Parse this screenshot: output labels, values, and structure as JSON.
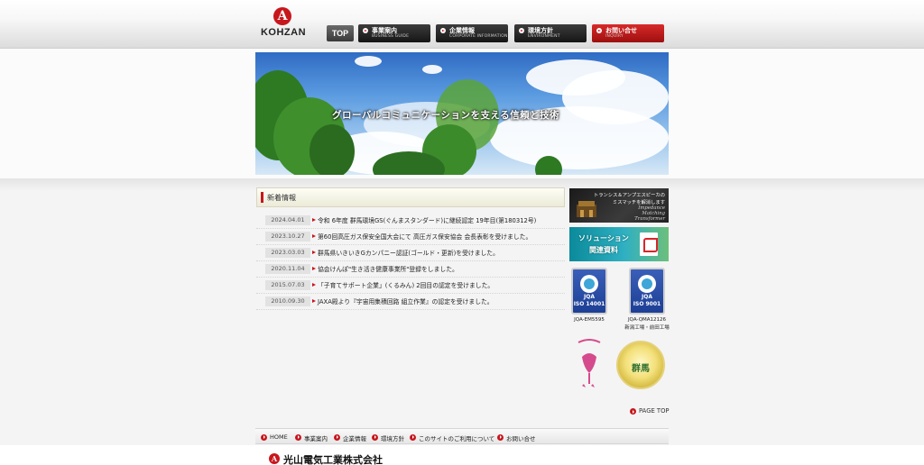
{
  "header": {
    "logo_mark": "A",
    "logo_text": "KOHZAN",
    "nav_top": "TOP",
    "nav": [
      {
        "jp": "事業案内",
        "en": "BUSINESS GUIDE"
      },
      {
        "jp": "企業情報",
        "en": "CORPORATE INFORMATION"
      },
      {
        "jp": "環境方針",
        "en": "ENVIRONMENT"
      },
      {
        "jp": "お問い合せ",
        "en": "INQUIRY"
      }
    ]
  },
  "hero": {
    "caption": "グローバルコミュニケーションを支える信頼と技術"
  },
  "news": {
    "title": "新着情報",
    "items": [
      {
        "date": "2024.04.01",
        "text": "令和 6年度 群馬環境GS(ぐんまスタンダード)に継続認定 19年目(第180312号)"
      },
      {
        "date": "2023.10.27",
        "text": "第60回高圧ガス保安全国大会にて 高圧ガス保安協会 会長表彰を受けました。"
      },
      {
        "date": "2023.03.03",
        "text": "群馬県いきいきGカンパニー認証(ゴールド・更新)を受けました。"
      },
      {
        "date": "2020.11.04",
        "text": "協会けんぽ\"生き活き健康事業所\"登録をしました。"
      },
      {
        "date": "2015.07.03",
        "text": "「子育てサポート企業」(くるみん) 2回目の認定を受けました。"
      },
      {
        "date": "2010.09.30",
        "text": "JAXA殿より『宇宙用集積回路 組立作業』の認定を受けました。"
      }
    ]
  },
  "side": {
    "banner1": {
      "line1": "トランシス＆アンプエスピーカの",
      "line2": "ミスマッチを解消します",
      "en1": "Impedance",
      "en2": "Matching",
      "en3": "Transformer"
    },
    "banner2": {
      "title": "ソリューション",
      "sub": "関連資料"
    },
    "iso1": {
      "jqa": "JQA",
      "num": "ISO 14001",
      "label": "JQA-EM5595"
    },
    "iso2": {
      "jqa": "JQA",
      "num": "ISO 9001",
      "label1": "JQA-QMA12126",
      "label2": "新潟工場・前田工場"
    },
    "kurumin": "くるみん",
    "seal": "群馬"
  },
  "page_top": "PAGE TOP",
  "footer": {
    "nav": [
      "HOME",
      "事業案内",
      "企業情報",
      "環境方針",
      "このサイトのご利用について",
      "お問い合せ"
    ],
    "company_mark": "A",
    "company_name": "光山電気工業株式会社"
  },
  "colors": {
    "brand_red": "#c8161d",
    "nav_dark": "#1f1f1f",
    "sky_blue": "#4d8fd8"
  }
}
